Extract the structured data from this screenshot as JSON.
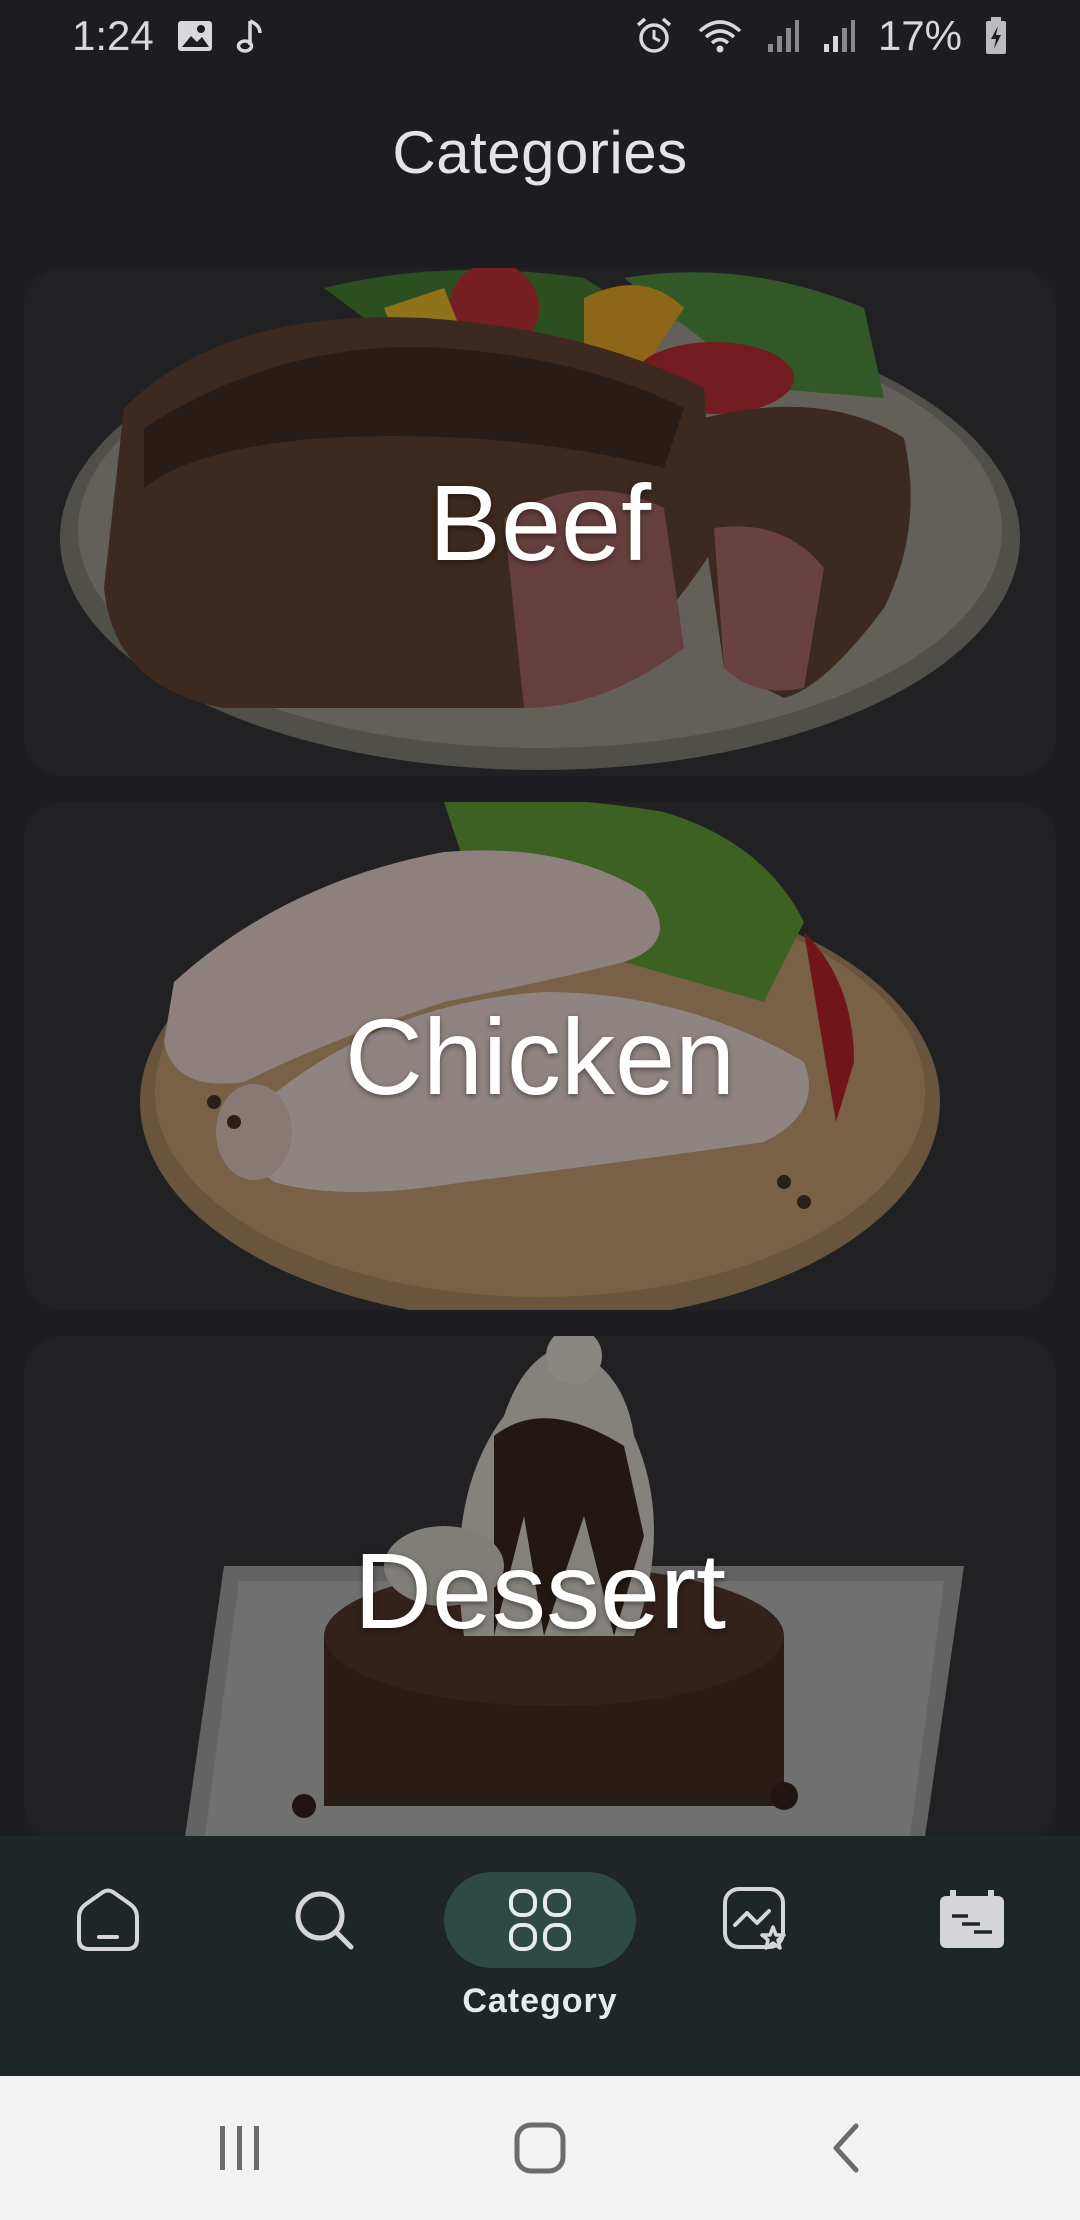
{
  "status_bar": {
    "time": "1:24",
    "battery_percent": "17%",
    "left_icons": [
      "gallery-icon",
      "music-note-icon"
    ],
    "right_icons": [
      "alarm-icon",
      "wifi-icon",
      "signal-icon",
      "signal-icon",
      "battery-charging-icon"
    ]
  },
  "header": {
    "title": "Categories"
  },
  "categories": [
    {
      "label": "Beef"
    },
    {
      "label": "Chicken"
    },
    {
      "label": "Dessert"
    }
  ],
  "bottom_nav": {
    "items": [
      {
        "icon": "home-icon",
        "label": ""
      },
      {
        "icon": "search-icon",
        "label": ""
      },
      {
        "icon": "category-grid-icon",
        "label": "Category",
        "active": true
      },
      {
        "icon": "favorites-gallery-icon",
        "label": ""
      },
      {
        "icon": "planner-icon",
        "label": ""
      }
    ],
    "active_color": "#2f4a44"
  },
  "system_nav": {
    "buttons": [
      "recents-icon",
      "home-button-icon",
      "back-icon"
    ]
  }
}
